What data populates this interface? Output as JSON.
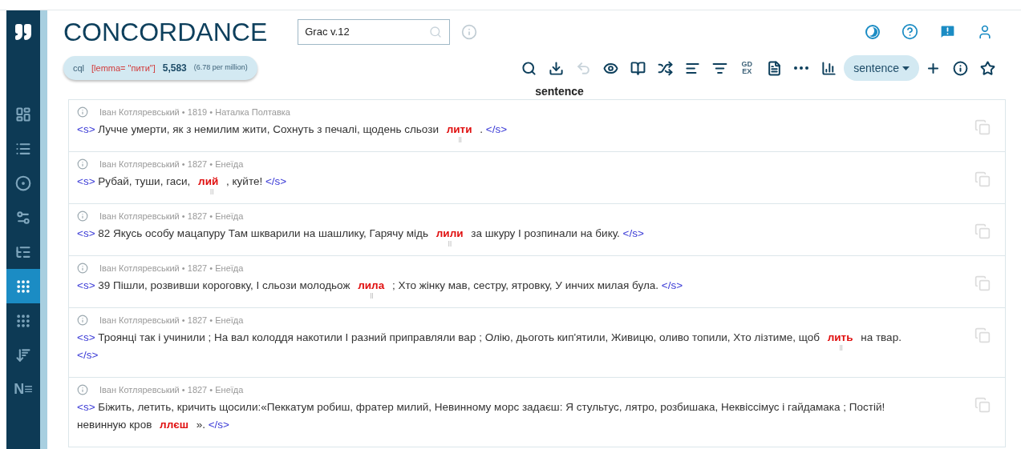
{
  "sidebar": {
    "items": [
      {
        "selected": false
      },
      {
        "selected": false
      },
      {
        "selected": false
      },
      {
        "selected": false
      },
      {
        "selected": false
      },
      {
        "selected": true
      },
      {
        "selected": false
      },
      {
        "selected": false
      },
      {
        "selected": false,
        "label": "N≡"
      }
    ]
  },
  "header": {
    "title": "CONCORDANCE",
    "corpus_field": {
      "value": "Grac v.12"
    }
  },
  "query": {
    "lang": "cql",
    "expression": "[lemma= \"пити\"]",
    "count": "5,583",
    "frequency": "(6.78 per million)"
  },
  "toolbar": {
    "undo_disabled": true,
    "gdex": "GD EX",
    "view": "sentence"
  },
  "column_heading": "sentence",
  "rows": [
    {
      "author": "Іван Котляревський",
      "sep": "•",
      "sep2": "•",
      "year": "1819",
      "work": "Наталка Полтавка",
      "open_tag": "<s>",
      "left": "Лучче умерти, як з немилим жити, Сохнуть з печалі, щодень сльози",
      "hit": "лити",
      "right": ". ",
      "close_tag": "</s>",
      "marker": "||"
    },
    {
      "author": "Іван Котляревський",
      "sep": "•",
      "sep2": "•",
      "year": "1827",
      "work": "Енеїда",
      "open_tag": "<s>",
      "left": "Рубай, туши, гаси,",
      "hit": "лий",
      "right": ", куйте! ",
      "close_tag": "</s>",
      "marker": "||"
    },
    {
      "author": "Іван Котляревський",
      "sep": "•",
      "sep2": "•",
      "year": "1827",
      "work": "Енеїда",
      "open_tag": "<s>",
      "left": "82 Якусь особу мацапуру Там шкварили на шашлику, Гарячу мідь",
      "hit": "лили",
      "right": "за шкуру І розпинали на бику. ",
      "close_tag": "</s>",
      "marker": "||"
    },
    {
      "author": "Іван Котляревський",
      "sep": "•",
      "sep2": "•",
      "year": "1827",
      "work": "Енеїда",
      "open_tag": "<s>",
      "left": "39 Пішли, розвивши короговку, І сльози молодьож",
      "hit": "лила",
      "right": "; Хто жінку мав, сестру, ятровку, У инчих милая була. ",
      "close_tag": "</s>",
      "marker": "||"
    },
    {
      "author": "Іван Котляревський",
      "sep": "•",
      "sep2": "•",
      "year": "1827",
      "work": "Енеїда",
      "open_tag": "<s>",
      "left": "Троянці так і учинили ; На вал колоддя накотили І разний приправляли вар ; Олію, дьоготь кип'ятили, Живицю, оливо топили, Хто лізтиме, щоб",
      "hit": "лить",
      "right": "на твар. ",
      "close_tag": "</s>",
      "marker": "||"
    },
    {
      "author": "Іван Котляревський",
      "sep": "•",
      "sep2": "•",
      "year": "1827",
      "work": "Енеїда",
      "open_tag": "<s>",
      "left": "Біжить, летить, кричить щосили:«Пеккатум робиш, фратер милий, Невинному морс задаєш: Я стультус, лятро, розбишака, Неквіссімус і гайдамака ; Постій! невинную кров",
      "hit": "ллєш",
      "right": "». ",
      "close_tag": "</s>"
    }
  ]
}
